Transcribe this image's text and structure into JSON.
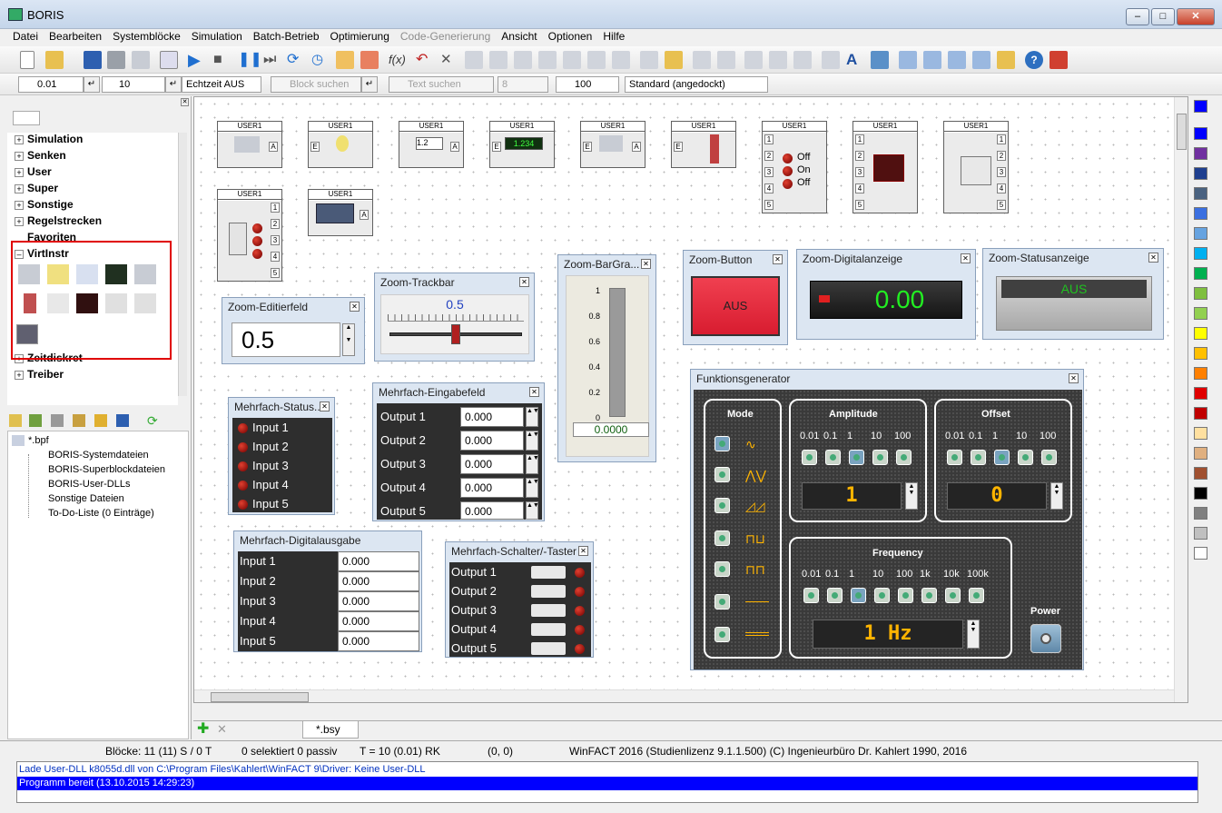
{
  "app": {
    "title": "BORIS"
  },
  "menu": [
    "Datei",
    "Bearbeiten",
    "Systemblöcke",
    "Simulation",
    "Batch-Betrieb",
    "Optimierung",
    "Code-Generierung",
    "Ansicht",
    "Optionen",
    "Hilfe"
  ],
  "toolbar2": {
    "step": "0.01",
    "end": "10",
    "realtime": "Echtzeit AUS",
    "block_search": "Block suchen",
    "text_search": "Text suchen",
    "count": "8",
    "width": "100",
    "layout": "Standard (angedockt)"
  },
  "categories": [
    "Simulation",
    "Senken",
    "User",
    "Super",
    "Sonstige",
    "Regelstrecken",
    "Favoriten",
    "VirtInstr",
    "Zeitdiskret",
    "Treiber"
  ],
  "tree": {
    "root": "*.bpf",
    "items": [
      "BORIS-Systemdateien",
      "BORIS-Superblockdateien",
      "BORIS-User-DLLs",
      "Sonstige Dateien",
      "To-Do-Liste (0 Einträge)"
    ]
  },
  "blocks": {
    "label": "USER1",
    "port_a": "A",
    "port_e": "E",
    "digit_value": "1.234",
    "leds": [
      "Off",
      "On",
      "Off"
    ]
  },
  "edit_field": {
    "title": "Zoom-Editierfeld",
    "value": "0.5"
  },
  "trackbar": {
    "title": "Zoom-Trackbar",
    "value": "0.5",
    "level": 0.5
  },
  "bargraph": {
    "title": "Zoom-BarGra...",
    "ticks": [
      "1",
      "0.8",
      "0.6",
      "0.4",
      "0.2",
      "0"
    ],
    "value": "0.0000"
  },
  "button": {
    "title": "Zoom-Button",
    "label": "AUS"
  },
  "digital": {
    "title": "Zoom-Digitalanzeige",
    "value": "0.00"
  },
  "status": {
    "title": "Zoom-Statusanzeige",
    "value": "AUS"
  },
  "multi_status": {
    "title": "Mehrfach-Status...",
    "rows": [
      "Input 1",
      "Input 2",
      "Input 3",
      "Input 4",
      "Input 5"
    ]
  },
  "multi_input": {
    "title": "Mehrfach-Eingabefeld",
    "rows": [
      "Output 1",
      "Output 2",
      "Output 3",
      "Output 4",
      "Output 5"
    ],
    "values": [
      "0.000",
      "0.000",
      "0.000",
      "0.000",
      "0.000"
    ]
  },
  "multi_digital": {
    "title": "Mehrfach-Digitalausgabe",
    "rows": [
      "Input 1",
      "Input 2",
      "Input 3",
      "Input 4",
      "Input 5"
    ],
    "values": [
      "0.000",
      "0.000",
      "0.000",
      "0.000",
      "0.000"
    ]
  },
  "multi_switch": {
    "title": "Mehrfach-Schalter/-Taster",
    "rows": [
      "Output 1",
      "Output 2",
      "Output 3",
      "Output 4",
      "Output 5"
    ]
  },
  "funcgen": {
    "title": "Funktionsgenerator",
    "mode": "Mode",
    "amplitude": "Amplitude",
    "offset": "Offset",
    "frequency": "Frequency",
    "power": "Power",
    "amp_labels": [
      "0.01",
      "0.1",
      "1",
      "10",
      "100"
    ],
    "freq_labels": [
      "0.01",
      "0.1",
      "1",
      "10",
      "100",
      "1k",
      "10k",
      "100k"
    ],
    "amp_value": "1",
    "offset_value": "0",
    "freq_value": "1 Hz"
  },
  "tab": "*.bsy",
  "statusbar": {
    "blocks": "Blöcke: 11 (11) S / 0 T",
    "selected": "0 selektiert  0 passiv",
    "time": "T = 10  (0.01)  RK",
    "coords": "(0, 0)",
    "license": "WinFACT 2016 (Studienlizenz 9.1.1.500)  (C) Ingenieurbüro Dr. Kahlert 1990, 2016"
  },
  "log": [
    "Lade User-DLL k8055d.dll von C:\\Program Files\\Kahlert\\WinFACT 9\\Driver: Keine User-DLL",
    "Programm bereit   (13.10.2015 14:29:23)"
  ],
  "colors": {
    "palette": [
      "#0000ff",
      "#0000ff",
      "#7030a0",
      "#1f3f8f",
      "#4a6280",
      "#3a6fe0",
      "#66a3e0",
      "#00b0f0",
      "#00b050",
      "#7fbf3f",
      "#92d050",
      "#ffff00",
      "#ffc000",
      "#ff8000",
      "#e00000",
      "#c00000",
      "#ffe0a0",
      "#e0b080",
      "#a05030",
      "#000000",
      "#808080",
      "#c0c0c0",
      "#ffffff"
    ]
  }
}
